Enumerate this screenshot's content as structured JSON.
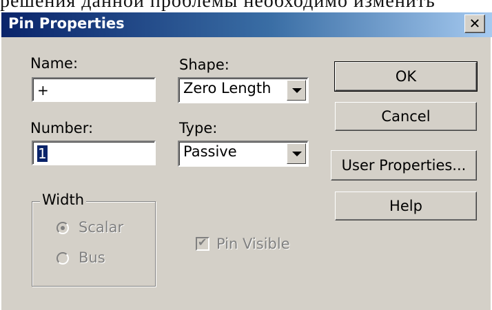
{
  "background_text": "решения данной проблемы необходимо изменить",
  "window": {
    "title": "Pin Properties",
    "close_glyph": "✕"
  },
  "fields": {
    "name": {
      "label": "Name:",
      "value": "+"
    },
    "number": {
      "label": "Number:",
      "value": "1"
    },
    "shape": {
      "label": "Shape:",
      "value": "Zero Length"
    },
    "type": {
      "label": "Type:",
      "value": "Passive"
    }
  },
  "width_group": {
    "legend": "Width",
    "options": [
      {
        "label": "Scalar",
        "checked": true
      },
      {
        "label": "Bus",
        "checked": false
      }
    ],
    "enabled": false
  },
  "pin_visible": {
    "label": "Pin Visible",
    "checked": true,
    "enabled": false
  },
  "buttons": {
    "ok": "OK",
    "cancel": "Cancel",
    "user_properties": "User Properties...",
    "help": "Help"
  },
  "colors": {
    "title_gradient_start": "#0a246a",
    "title_gradient_end": "#a6caf0",
    "dialog_face": "#d4d0c8",
    "disabled_text": "#808080"
  }
}
